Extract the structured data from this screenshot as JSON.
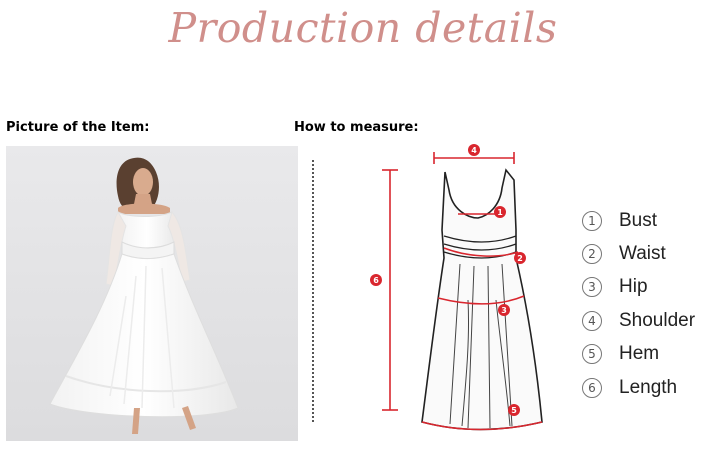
{
  "title": "Production details",
  "left_label": "Picture of the Item:",
  "right_label": "How to measure:",
  "diagram_markers": [
    "1",
    "2",
    "3",
    "4",
    "5",
    "6"
  ],
  "legend": [
    {
      "num": "1",
      "text": "Bust"
    },
    {
      "num": "2",
      "text": "Waist"
    },
    {
      "num": "3",
      "text": "Hip"
    },
    {
      "num": "4",
      "text": "Shoulder"
    },
    {
      "num": "5",
      "text": "Hem"
    },
    {
      "num": "6",
      "text": "Length"
    }
  ],
  "colors": {
    "title": "#d08f8b",
    "marker": "#d9262e"
  }
}
